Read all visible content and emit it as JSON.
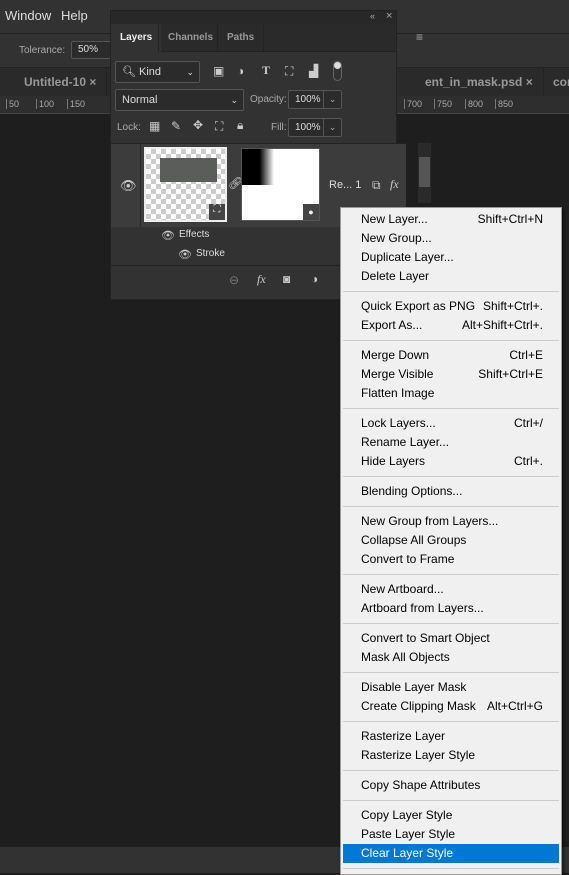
{
  "menubar": {
    "items": [
      "Window",
      "Help"
    ]
  },
  "options": {
    "tolerance_label": "Tolerance:",
    "tolerance_value": "50%"
  },
  "doc_tabs": [
    "Untitled-10",
    "ent_in_mask.psd",
    "cor"
  ],
  "ruler": [
    "50",
    "100",
    "150",
    "700",
    "750",
    "800",
    "850"
  ],
  "layers_panel": {
    "tabs": [
      "Layers",
      "Channels",
      "Paths"
    ],
    "active_tab": "Layers",
    "filter": "Kind",
    "blend_mode": "Normal",
    "opacity_label": "Opacity:",
    "opacity": "100%",
    "lock_label": "Lock:",
    "fill_label": "Fill:",
    "fill": "100%",
    "layer": {
      "name": "Re... 1",
      "effects_label": "Effects",
      "effect": "Stroke"
    }
  },
  "context_menu": {
    "selected": "Clear Layer Style",
    "groups": [
      [
        {
          "label": "New Layer...",
          "shortcut": "Shift+Ctrl+N"
        },
        {
          "label": "New Group...",
          "shortcut": ""
        },
        {
          "label": "Duplicate Layer...",
          "shortcut": ""
        },
        {
          "label": "Delete Layer",
          "shortcut": ""
        }
      ],
      [
        {
          "label": "Quick Export as PNG",
          "shortcut": "Shift+Ctrl+."
        },
        {
          "label": "Export As...",
          "shortcut": "Alt+Shift+Ctrl+."
        }
      ],
      [
        {
          "label": "Merge Down",
          "shortcut": "Ctrl+E"
        },
        {
          "label": "Merge Visible",
          "shortcut": "Shift+Ctrl+E"
        },
        {
          "label": "Flatten Image",
          "shortcut": ""
        }
      ],
      [
        {
          "label": "Lock Layers...",
          "shortcut": "Ctrl+/"
        },
        {
          "label": "Rename Layer...",
          "shortcut": ""
        },
        {
          "label": "Hide Layers",
          "shortcut": "Ctrl+."
        }
      ],
      [
        {
          "label": "Blending Options...",
          "shortcut": ""
        }
      ],
      [
        {
          "label": "New Group from Layers...",
          "shortcut": ""
        },
        {
          "label": "Collapse All Groups",
          "shortcut": ""
        },
        {
          "label": "Convert to Frame",
          "shortcut": ""
        }
      ],
      [
        {
          "label": "New Artboard...",
          "shortcut": ""
        },
        {
          "label": "Artboard from Layers...",
          "shortcut": ""
        }
      ],
      [
        {
          "label": "Convert to Smart Object",
          "shortcut": ""
        },
        {
          "label": "Mask All Objects",
          "shortcut": ""
        }
      ],
      [
        {
          "label": "Disable Layer Mask",
          "shortcut": ""
        },
        {
          "label": "Create Clipping Mask",
          "shortcut": "Alt+Ctrl+G"
        }
      ],
      [
        {
          "label": "Rasterize Layer",
          "shortcut": ""
        },
        {
          "label": "Rasterize Layer Style",
          "shortcut": ""
        }
      ],
      [
        {
          "label": "Copy Shape Attributes",
          "shortcut": ""
        }
      ],
      [
        {
          "label": "Copy Layer Style",
          "shortcut": ""
        },
        {
          "label": "Paste Layer Style",
          "shortcut": ""
        },
        {
          "label": "Clear Layer Style",
          "shortcut": ""
        }
      ]
    ]
  },
  "colors": {
    "highlight": "#0078d7",
    "panel": "#323232",
    "canvas": "#1e1e1e"
  }
}
